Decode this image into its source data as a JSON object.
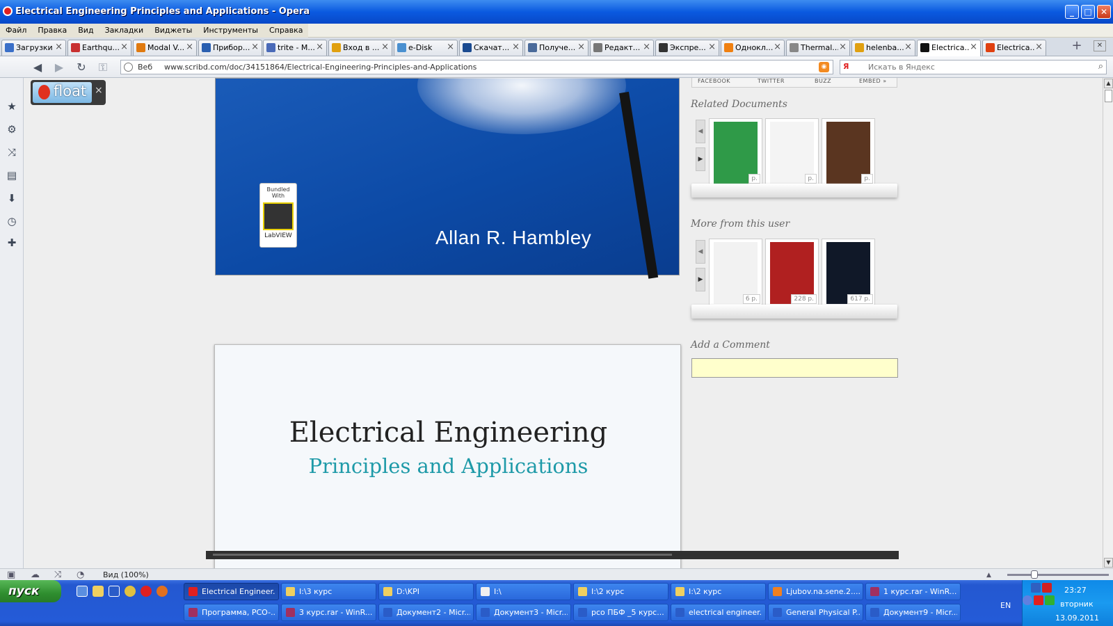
{
  "window": {
    "title": "Electrical Engineering Principles and Applications - Opera",
    "controls": {
      "minimize": "_",
      "maximize": "□",
      "close": "✕"
    }
  },
  "menu": [
    "Файл",
    "Правка",
    "Вид",
    "Закладки",
    "Виджеты",
    "Инструменты",
    "Справка"
  ],
  "tabs": [
    {
      "label": "Загрузки",
      "color": "#3a6fc8"
    },
    {
      "label": "Earthqu...",
      "color": "#c83030"
    },
    {
      "label": "Modal V...",
      "color": "#e07a10"
    },
    {
      "label": "Прибор...",
      "color": "#2a5fb0"
    },
    {
      "label": "trite - M...",
      "color": "#4a6ab8"
    },
    {
      "label": "Вход в ...",
      "color": "#e0a010"
    },
    {
      "label": "e-Disk",
      "color": "#4a90d0"
    },
    {
      "label": "Скачат...",
      "color": "#1a4a90"
    },
    {
      "label": "Получе...",
      "color": "#4a6a9a"
    },
    {
      "label": "Редакт...",
      "color": "#777777"
    },
    {
      "label": "Экспре...",
      "color": "#333333"
    },
    {
      "label": "Однокл...",
      "color": "#f08010"
    },
    {
      "label": "Thermal...",
      "color": "#888888"
    },
    {
      "label": "helenba...",
      "color": "#e0a010"
    },
    {
      "label": "Electrica...",
      "color": "#111111"
    },
    {
      "label": "Electrica...",
      "color": "#e04010"
    }
  ],
  "address": {
    "web_label": "Веб",
    "url": "www.scribd.com/doc/34151864/Electrical-Engineering-Principles-and-Applications",
    "search_placeholder": "Искать в Яндекс",
    "search_engine": "Я"
  },
  "float_widget": {
    "label": "float",
    "close": "×"
  },
  "document": {
    "cover_badge_top": "Bundled With",
    "cover_badge_bottom": "LabVIEW",
    "author": "Allan R. Hambley",
    "title": "Electrical Engineering",
    "subtitle": "Principles and Applications"
  },
  "share": {
    "facebook": "FACEBOOK",
    "twitter": "TWITTER",
    "buzz": "BUZZ",
    "embed": "EMBED »"
  },
  "related": {
    "heading": "Related Documents",
    "items": [
      {
        "pages": "p.",
        "color": "#2f9a48"
      },
      {
        "pages": "p.",
        "color": "#f4f4f4"
      },
      {
        "pages": "p.",
        "color": "#5a3520"
      }
    ]
  },
  "more": {
    "heading": "More from this user",
    "items": [
      {
        "pages": "6 p.",
        "color": "#f2f2f2"
      },
      {
        "pages": "228 p.",
        "color": "#b02020"
      },
      {
        "pages": "617 p.",
        "color": "#101828"
      }
    ]
  },
  "comment": {
    "heading": "Add a Comment",
    "value": ""
  },
  "status": {
    "zoom": "Вид (100%)"
  },
  "taskbar": {
    "start": "пуск",
    "row1": [
      {
        "label": "Electrical Engineer...",
        "color": "#e02020",
        "active": true
      },
      {
        "label": "I:\\3 курс",
        "color": "#f0d060"
      },
      {
        "label": "D:\\KPI",
        "color": "#f0d060"
      },
      {
        "label": "I:\\",
        "color": "#f0f0f0"
      },
      {
        "label": "I:\\2 курс",
        "color": "#f0d060"
      },
      {
        "label": "I:\\2 курс",
        "color": "#f0d060"
      },
      {
        "label": "Ljubov.na.sene.2....",
        "color": "#f08020"
      },
      {
        "label": "1 курс.rar - WinR...",
        "color": "#a03060"
      }
    ],
    "row2": [
      {
        "label": "Программа, PCO-...",
        "color": "#a03060"
      },
      {
        "label": "3 курс.rar - WinR...",
        "color": "#a03060"
      },
      {
        "label": "Документ2 - Micr...",
        "color": "#2a5cc8"
      },
      {
        "label": "Документ3 - Micr...",
        "color": "#2a5cc8"
      },
      {
        "label": "рсо ПБФ _5 курс...",
        "color": "#2a5cc8"
      },
      {
        "label": "electrical engineer...",
        "color": "#2a5cc8"
      },
      {
        "label": "General Physical P...",
        "color": "#2a5cc8"
      },
      {
        "label": "Документ9 - Micr...",
        "color": "#2a5cc8"
      }
    ],
    "lang": "EN",
    "time": "23:27",
    "day": "вторник",
    "date": "13.09.2011"
  }
}
